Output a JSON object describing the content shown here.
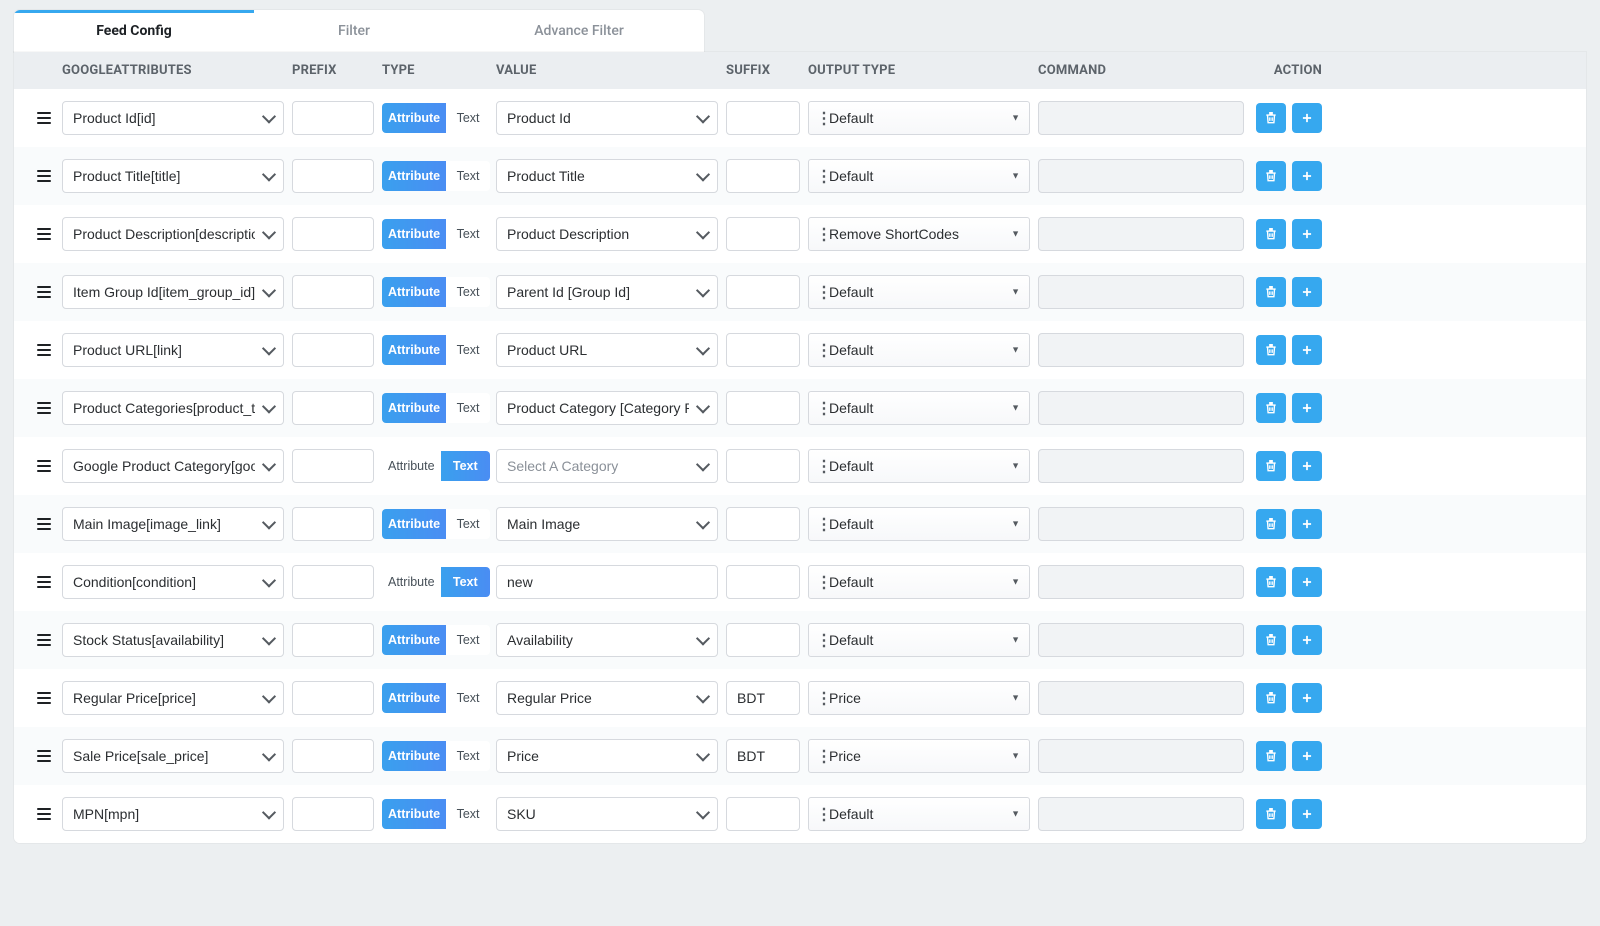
{
  "tabs": {
    "feed_config": "Feed Config",
    "filter": "Filter",
    "advance_filter": "Advance Filter"
  },
  "headers": {
    "google_attributes": "GOOGLEATTRIBUTES",
    "prefix": "PREFIX",
    "type": "TYPE",
    "value": "VALUE",
    "suffix": "SUFFIX",
    "output_type": "OUTPUT TYPE",
    "command": "COMMAND",
    "action": "ACTION"
  },
  "type_labels": {
    "attribute": "Attribute",
    "text": "Text"
  },
  "value_placeholder": "Select A Category",
  "rows": [
    {
      "attr": "Product Id[id]",
      "prefix": "",
      "type": "attribute",
      "value": "Product Id",
      "value_kind": "select",
      "suffix": "",
      "output": "Default",
      "command": ""
    },
    {
      "attr": "Product Title[title]",
      "prefix": "",
      "type": "attribute",
      "value": "Product Title",
      "value_kind": "select",
      "suffix": "",
      "output": "Default",
      "command": ""
    },
    {
      "attr": "Product Description[description]",
      "prefix": "",
      "type": "attribute",
      "value": "Product Description",
      "value_kind": "select",
      "suffix": "",
      "output": "Remove ShortCodes",
      "command": ""
    },
    {
      "attr": "Item Group Id[item_group_id]",
      "prefix": "",
      "type": "attribute",
      "value": "Parent Id [Group Id]",
      "value_kind": "select",
      "suffix": "",
      "output": "Default",
      "command": ""
    },
    {
      "attr": "Product URL[link]",
      "prefix": "",
      "type": "attribute",
      "value": "Product URL",
      "value_kind": "select",
      "suffix": "",
      "output": "Default",
      "command": ""
    },
    {
      "attr": "Product Categories[product_type]",
      "prefix": "",
      "type": "attribute",
      "value": "Product Category [Category Path]",
      "value_kind": "select",
      "suffix": "",
      "output": "Default",
      "command": ""
    },
    {
      "attr": "Google Product Category[google_product_category]",
      "prefix": "",
      "type": "text",
      "value": "",
      "value_kind": "select_placeholder",
      "suffix": "",
      "output": "Default",
      "command": ""
    },
    {
      "attr": "Main Image[image_link]",
      "prefix": "",
      "type": "attribute",
      "value": "Main Image",
      "value_kind": "select",
      "suffix": "",
      "output": "Default",
      "command": ""
    },
    {
      "attr": "Condition[condition]",
      "prefix": "",
      "type": "text",
      "value": "new",
      "value_kind": "input",
      "suffix": "",
      "output": "Default",
      "command": ""
    },
    {
      "attr": "Stock Status[availability]",
      "prefix": "",
      "type": "attribute",
      "value": "Availability",
      "value_kind": "select",
      "suffix": "",
      "output": "Default",
      "command": ""
    },
    {
      "attr": "Regular Price[price]",
      "prefix": "",
      "type": "attribute",
      "value": "Regular Price",
      "value_kind": "select",
      "suffix": "BDT",
      "output": "Price",
      "command": ""
    },
    {
      "attr": "Sale Price[sale_price]",
      "prefix": "",
      "type": "attribute",
      "value": "Price",
      "value_kind": "select",
      "suffix": "BDT",
      "output": "Price",
      "command": ""
    },
    {
      "attr": "MPN[mpn]",
      "prefix": "",
      "type": "attribute",
      "value": "SKU",
      "value_kind": "select",
      "suffix": "",
      "output": "Default",
      "command": ""
    }
  ]
}
